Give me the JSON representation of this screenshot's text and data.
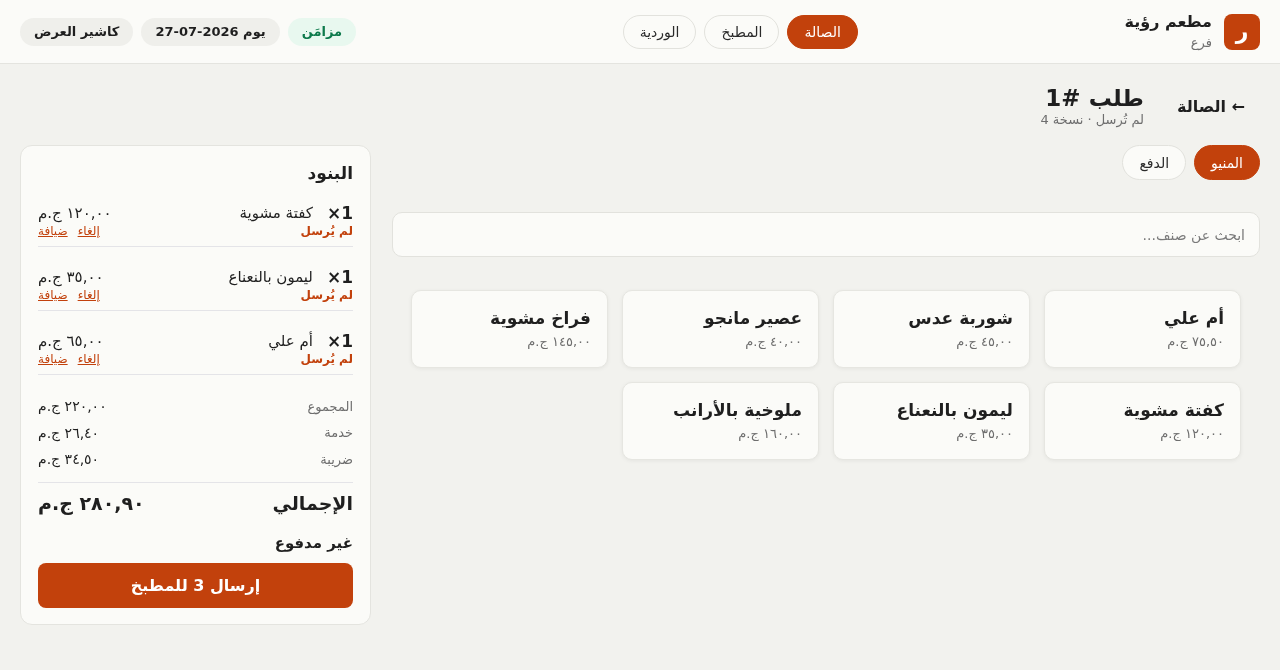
{
  "header": {
    "logo": "ر",
    "restaurant": "مطعم رؤية",
    "branch": "فرع",
    "nav": [
      {
        "label": "الصالة",
        "selected": true
      },
      {
        "label": "المطبخ",
        "selected": false
      },
      {
        "label": "الوردية",
        "selected": false
      }
    ],
    "chips": [
      {
        "kind": "sync",
        "text": "مزامَن"
      },
      {
        "kind": "date",
        "text": "يوم 2026-07-27"
      },
      {
        "kind": "user",
        "text": "كاشير العرض"
      }
    ]
  },
  "order": {
    "back_link": "← الصالة",
    "title": "طلب #1",
    "subtitle": "لم تُرسل · نسخة 4",
    "tabs": [
      {
        "label": "المنيو",
        "selected": true
      },
      {
        "label": "الدفع",
        "selected": false
      }
    ]
  },
  "search": {
    "placeholder": "ابحث عن صنف..."
  },
  "menu_items": [
    {
      "name": "أم علي",
      "price": "٧٥,٥٠ ج.م"
    },
    {
      "name": "شوربة عدس",
      "price": "٤٥,٠٠ ج.م"
    },
    {
      "name": "عصير مانجو",
      "price": "٤٠,٠٠ ج.م"
    },
    {
      "name": "فراخ مشوية",
      "price": "١٤٥,٠٠ ج.م"
    },
    {
      "name": "كفتة مشوية",
      "price": "١٢٠,٠٠ ج.م"
    },
    {
      "name": "ليمون بالنعناع",
      "price": "٣٥,٠٠ ج.م"
    },
    {
      "name": "ملوخية بالأرانب",
      "price": "١٦٠,٠٠ ج.م"
    }
  ],
  "cart": {
    "title": "البنود",
    "items": [
      {
        "qty": "1×",
        "name": "كفتة مشوية",
        "price": "١٢٠,٠٠ ج.م",
        "status": "لم يُرسل",
        "actions": [
          "إلغاء",
          "ضيافة"
        ]
      },
      {
        "qty": "1×",
        "name": "ليمون بالنعناع",
        "price": "٣٥,٠٠ ج.م",
        "status": "لم يُرسل",
        "actions": [
          "إلغاء",
          "ضيافة"
        ]
      },
      {
        "qty": "1×",
        "name": "أم علي",
        "price": "٦٥,٠٠ ج.م",
        "status": "لم يُرسل",
        "actions": [
          "إلغاء",
          "ضيافة"
        ]
      }
    ],
    "totals": [
      {
        "label": "المجموع",
        "value": "٢٢٠,٠٠ ج.م"
      },
      {
        "label": "خدمة",
        "value": "٢٦,٤٠ ج.م"
      },
      {
        "label": "ضريبة",
        "value": "٣٤,٥٠ ج.م"
      }
    ],
    "grand_total": {
      "label": "الإجمالي",
      "value": "٢٨٠,٩٠ ج.م"
    },
    "payment_status": "غير مدفوع",
    "send_button": "إرسال 3 للمطبخ"
  }
}
